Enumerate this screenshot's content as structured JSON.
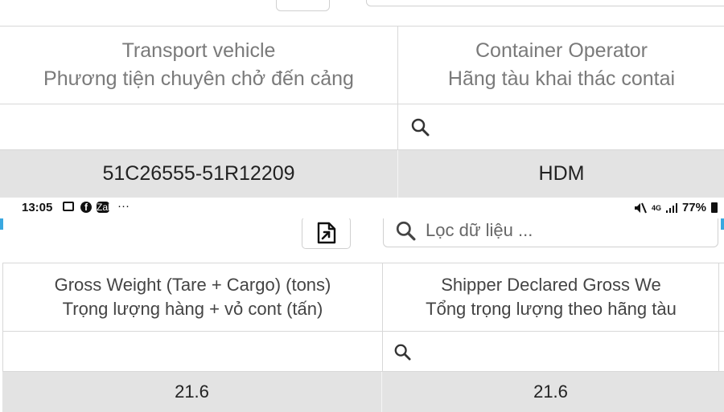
{
  "top_section": {
    "columns": [
      {
        "title_en": "Transport vehicle",
        "title_vi": "Phương tiện chuyên chở đến cảng"
      },
      {
        "title_en": "Container Operator",
        "title_vi": "Hãng tàu khai thác contai"
      }
    ],
    "row": [
      "51C26555-51R12209",
      "HDM"
    ],
    "filter_icon": "search-icon"
  },
  "status_bar": {
    "time": "13:05",
    "left_icons": [
      "gallery-icon",
      "facebook-icon",
      "zalo-icon"
    ],
    "zalo_text": "Zalo",
    "more": "···",
    "network": "4G",
    "battery": "77%",
    "right_icons": [
      "mute-icon",
      "signal-icon",
      "battery-icon"
    ]
  },
  "bottom_section": {
    "export_icon": "export-file-icon",
    "search": {
      "placeholder": "Lọc dữ liệu ...",
      "value": ""
    },
    "columns": [
      {
        "title_en": "Gross Weight (Tare + Cargo) (tons)",
        "title_vi": "Trọng lượng hàng + vỏ cont (tấn)"
      },
      {
        "title_en": "Shipper Declared Gross We",
        "title_vi": "Tổng trọng lượng theo hãng tàu"
      }
    ],
    "row": [
      "21.6",
      "21.6"
    ],
    "filter_icon": "search-icon"
  },
  "colors": {
    "row_bg": "#e3e3e3",
    "border": "#d8d8d8",
    "accent": "#3aa8e0"
  }
}
